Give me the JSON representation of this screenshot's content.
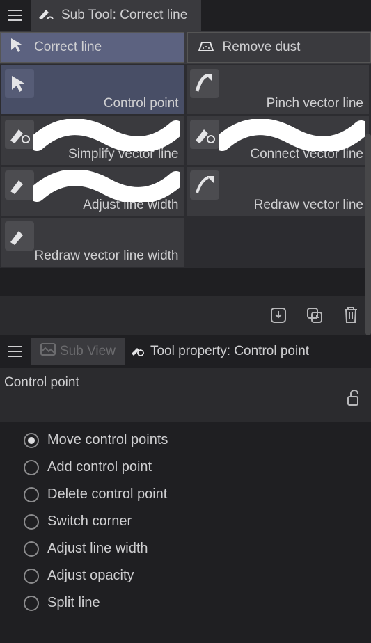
{
  "subtool_header": {
    "title": "Sub Tool: Correct line"
  },
  "mode_row": {
    "correct_line": "Correct line",
    "remove_dust": "Remove dust"
  },
  "tools": [
    {
      "label": "Control point",
      "icon": "cursor-icon",
      "highlighted": true
    },
    {
      "label": "Pinch vector line",
      "icon": "pinch-icon",
      "highlighted": false
    },
    {
      "label": "Simplify vector line",
      "icon": "pen-curve-icon",
      "highlighted": false
    },
    {
      "label": "Connect vector line",
      "icon": "pen-curve-icon",
      "highlighted": false
    },
    {
      "label": "Adjust line width",
      "icon": "pen-width-icon",
      "highlighted": false
    },
    {
      "label": "Redraw vector line",
      "icon": "redraw-icon",
      "highlighted": false
    },
    {
      "label": "Redraw vector line width",
      "icon": "pen-width-icon",
      "highlighted": false
    }
  ],
  "action_icons": [
    "download-icon",
    "duplicate-icon",
    "trash-icon"
  ],
  "prop_header": {
    "subview_label": "Sub View",
    "tool_property_label": "Tool property: Control point"
  },
  "prop_panel": {
    "name": "Control point",
    "options": [
      "Move control points",
      "Add control point",
      "Delete control point",
      "Switch corner",
      "Adjust line width",
      "Adjust opacity",
      "Split line"
    ],
    "selected_index": 0
  }
}
